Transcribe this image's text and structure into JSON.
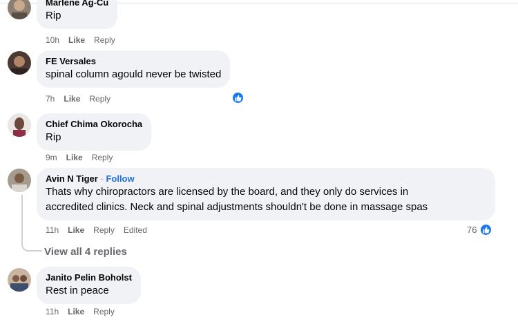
{
  "comments": [
    {
      "author": "Marlene Ag-Cu",
      "text": "Rip",
      "time": "10h",
      "like": "Like",
      "reply": "Reply"
    },
    {
      "author": "FE Versales",
      "text": "spinal column agould never be twisted",
      "time": "7h",
      "like": "Like",
      "reply": "Reply"
    },
    {
      "author": "Chief Chima Okorocha",
      "text": "Rip",
      "time": "9m",
      "like": "Like",
      "reply": "Reply"
    },
    {
      "author": "Avin N Tiger",
      "follow": "Follow",
      "text_line1": "Thats why chiropractors are licensed by the board, and they only do services in",
      "text_line2": "accredited clinics. Neck and spinal adjustments shouldn't be done in massage spas",
      "time": "11h",
      "like": "Like",
      "reply": "Reply",
      "edited": "Edited",
      "reactions": "76"
    },
    {
      "author": "Janito Pelin Boholst",
      "text": "Rest in peace",
      "time": "11h",
      "like": "Like",
      "reply": "Reply"
    }
  ],
  "view_replies": "View all 4 replies",
  "separator": "·",
  "icons": {
    "reaction": "thumbs-up-icon"
  },
  "colors": {
    "like_blue": "#1877f2",
    "follow_blue": "#216fdb",
    "bubble": "#f0f2f5",
    "meta": "#65676b"
  }
}
